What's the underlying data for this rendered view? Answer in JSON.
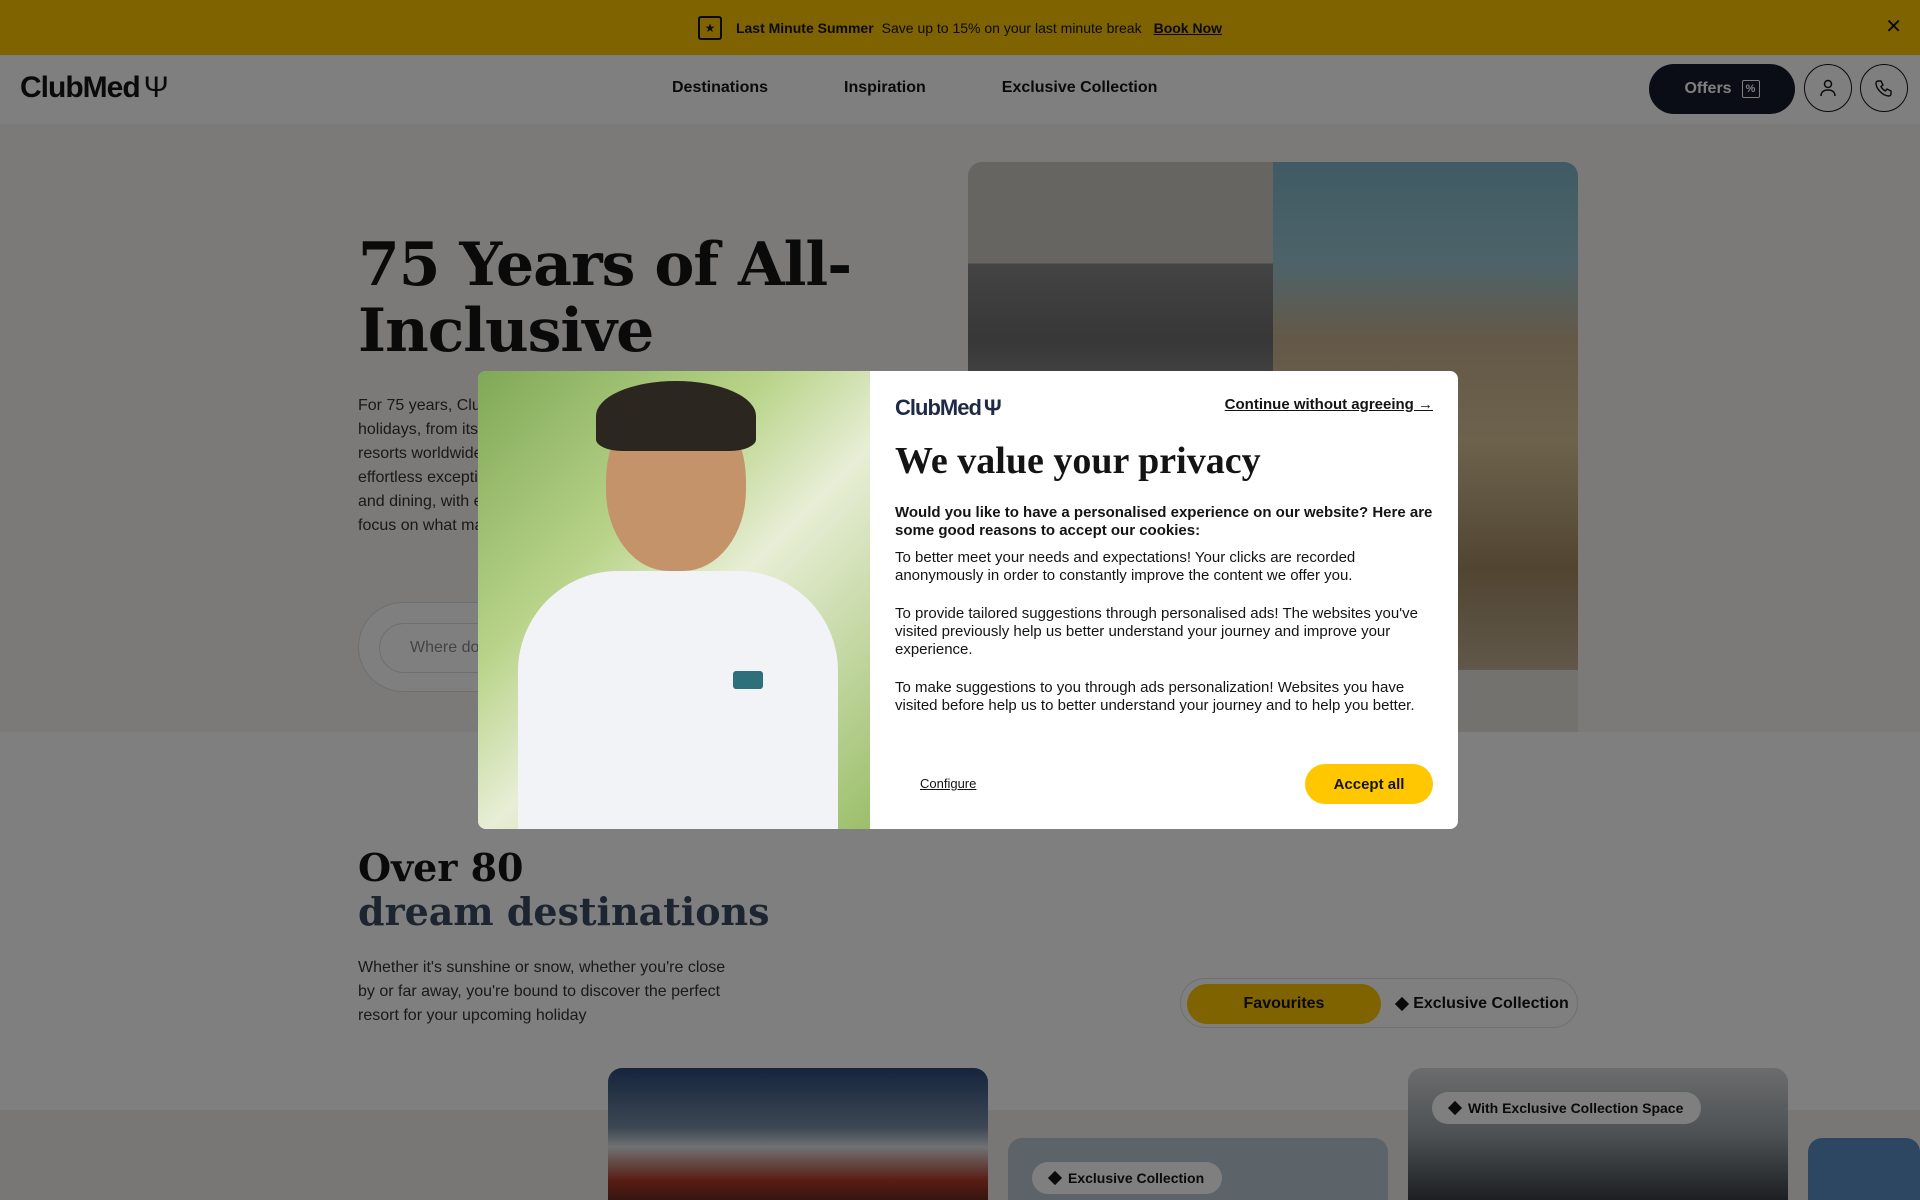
{
  "promo": {
    "icon": "calendar-star-icon",
    "title": "Last Minute Summer",
    "text": "Save up to 15% on your last minute break",
    "link": "Book Now",
    "close": "✕"
  },
  "header": {
    "logo": "ClubMed",
    "nav": [
      "Destinations",
      "Inspiration",
      "Exclusive Collection"
    ],
    "offers_label": "Offers",
    "account_icon": "user-icon",
    "phone_icon": "phone-icon"
  },
  "hero": {
    "title": "75 Years of All-Inclusive",
    "text": "For 75 years, Club Med has pioneered all-inclusive holidays, from its first village in Majorca to over 60 resorts worldwide, continuing to lead the way by offering effortless exceptional stays, pairing sports and activities, and dining, with everything taken care of, so you can focus on what matters most",
    "search_placeholder": "Where do you want to go?"
  },
  "destinations": {
    "title_line1": "Over 80",
    "title_line2": "dream destinations",
    "text": "Whether it's sunshine or snow, whether you're close by or far away, you're bound to discover the perfect resort for your upcoming holiday",
    "toggle": {
      "favourites": "Favourites",
      "exclusive": "Exclusive Collection"
    },
    "card_badges": [
      "Exclusive Collection",
      "With Exclusive Collection Space"
    ]
  },
  "modal": {
    "logo": "ClubMed",
    "continue": "Continue without agreeing →",
    "title": "We value your privacy",
    "lead": "Would you like to have a personalised experience on our website? Here are some good reasons to accept our cookies:",
    "paragraphs": [
      "To better meet your needs and expectations! Your clicks are recorded anonymously in order to constantly improve the content we offer you.",
      "To provide tailored suggestions through personalised ads! The websites you've visited previously help us better understand your journey and improve your experience.",
      "To make suggestions to you through ads personalization! Websites you have visited before help us to better understand your journey and to help you better."
    ],
    "configure": "Configure",
    "accept": "Accept all"
  }
}
